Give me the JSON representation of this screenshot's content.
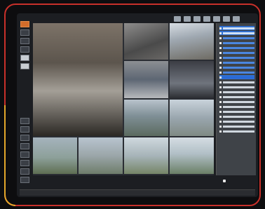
{
  "app": {
    "title": ""
  },
  "toolbar": {
    "buttons": [
      "view-1x1",
      "view-2x2",
      "view-3x3",
      "view-4x4",
      "layout-custom",
      "fullscreen",
      "settings"
    ]
  },
  "left_rail": {
    "top_buttons": [
      "camera-select",
      "ptz",
      "playback",
      "snapshot",
      "record",
      "alarm"
    ],
    "bottom_buttons": [
      "zoom-in",
      "zoom-out",
      "focus-near",
      "focus-far",
      "iris-open",
      "iris-close",
      "preset",
      "tour"
    ]
  },
  "cameras": [
    {
      "label": ""
    },
    {
      "label": ""
    },
    {
      "label": ""
    },
    {
      "label": ""
    },
    {
      "label": ""
    },
    {
      "label": ""
    },
    {
      "label": ""
    },
    {
      "label": ""
    },
    {
      "label": ""
    },
    {
      "label": ""
    },
    {
      "label": ""
    },
    {
      "label": ""
    },
    {
      "label": ""
    }
  ],
  "device_tree": {
    "items_count_visible": 26
  },
  "status": {
    "text": ""
  },
  "accent_colors": {
    "frame": "#c8302a",
    "frame_accent": "#e3a72a",
    "selection": "#2f6fd0"
  }
}
